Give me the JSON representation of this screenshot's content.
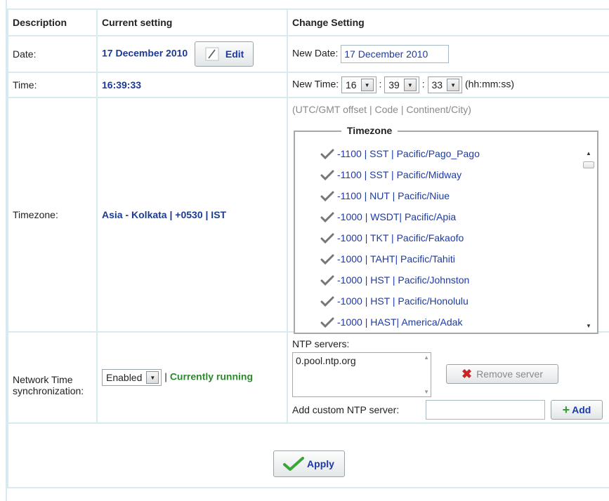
{
  "headers": {
    "description": "Description",
    "current": "Current setting",
    "change": "Change Setting"
  },
  "date": {
    "label": "Date:",
    "current": "17 December 2010",
    "edit_label": "Edit",
    "new_label": "New Date:",
    "new_value": "17 December 2010"
  },
  "time": {
    "label": "Time:",
    "current": "16:39:33",
    "new_label": "New Time:",
    "hour": "16",
    "minute": "39",
    "second": "33",
    "separator": ":",
    "format": "(hh:mm:ss)"
  },
  "timezone": {
    "label": "Timezone:",
    "current": "Asia - Kolkata | +0530 | IST",
    "hint": "(UTC/GMT offset | Code | Continent/City)",
    "legend": "Timezone",
    "items": [
      "-1100 | SST | Pacific/Pago_Pago",
      "-1100 | SST | Pacific/Midway",
      "-1100 | NUT | Pacific/Niue",
      "-1000 | WSDT| Pacific/Apia",
      "-1000 | TKT | Pacific/Fakaofo",
      "-1000 | TAHT| Pacific/Tahiti",
      "-1000 | HST | Pacific/Johnston",
      "-1000 | HST | Pacific/Honolulu",
      "-1000 | HAST| America/Adak"
    ]
  },
  "ntp": {
    "label": "Network Time synchronization:",
    "select_value": "Enabled",
    "status_sep": "|",
    "status": "Currently running",
    "servers_label": "NTP servers:",
    "servers": [
      "0.pool.ntp.org"
    ],
    "remove_label": "Remove server",
    "add_custom_label": "Add custom NTP server:",
    "add_custom_value": "",
    "add_label": "Add"
  },
  "apply_label": "Apply",
  "colors": {
    "border": "#d6ebef",
    "link_blue": "#1b3aa8",
    "label_blue": "#1b3a96",
    "running_green": "#2b8a2b"
  }
}
